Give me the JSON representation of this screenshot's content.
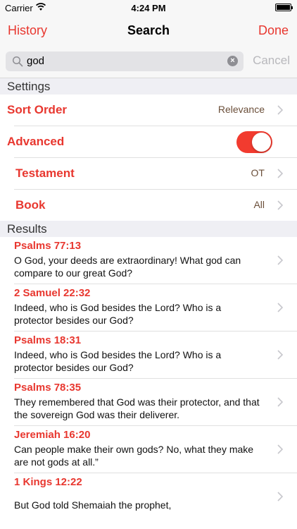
{
  "status": {
    "carrier": "Carrier",
    "time": "4:24 PM"
  },
  "nav": {
    "left": "History",
    "title": "Search",
    "right": "Done"
  },
  "search": {
    "query": "god",
    "cancel": "Cancel"
  },
  "settings": {
    "header": "Settings",
    "sort_order": {
      "label": "Sort Order",
      "value": "Relevance"
    },
    "advanced": {
      "label": "Advanced",
      "enabled": true
    },
    "testament": {
      "label": "Testament",
      "value": "OT"
    },
    "book": {
      "label": "Book",
      "value": "All"
    }
  },
  "results": {
    "header": "Results",
    "items": [
      {
        "ref": "Psalms 77:13",
        "text": "O God, your deeds are extraordinary! What god can compare to our great God?"
      },
      {
        "ref": "2 Samuel 22:32",
        "text": "Indeed, who is God besides the Lord? Who is a protector besides our God?"
      },
      {
        "ref": "Psalms 18:31",
        "text": "Indeed, who is God besides the Lord? Who is a protector besides our God?"
      },
      {
        "ref": "Psalms 78:35",
        "text": "They remembered that God was their protector, and that the sovereign God was their deliverer."
      },
      {
        "ref": "Jeremiah 16:20",
        "text": "Can people make their own gods? No, what they make are not gods at all.”"
      },
      {
        "ref": "1 Kings 12:22",
        "text": "But God told Shemaiah the prophet,"
      }
    ]
  },
  "colors": {
    "accent": "#e8372f",
    "toggle_on": "#f23b2f"
  }
}
